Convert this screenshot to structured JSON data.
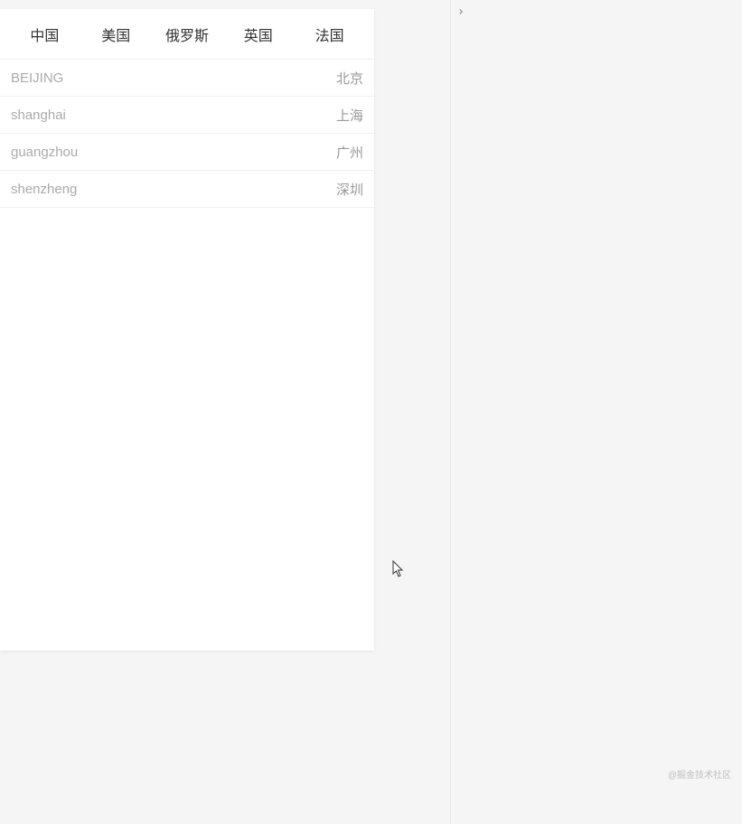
{
  "tabs": [
    {
      "label": "中国"
    },
    {
      "label": "美国"
    },
    {
      "label": "俄罗斯"
    },
    {
      "label": "英国"
    },
    {
      "label": "法国"
    }
  ],
  "cities": [
    {
      "pinyin": "BEIJING",
      "cn": "北京"
    },
    {
      "pinyin": "shanghai",
      "cn": "上海"
    },
    {
      "pinyin": "guangzhou",
      "cn": "广州"
    },
    {
      "pinyin": "shenzheng",
      "cn": "深圳"
    }
  ],
  "watermark": "@掘金技术社区"
}
